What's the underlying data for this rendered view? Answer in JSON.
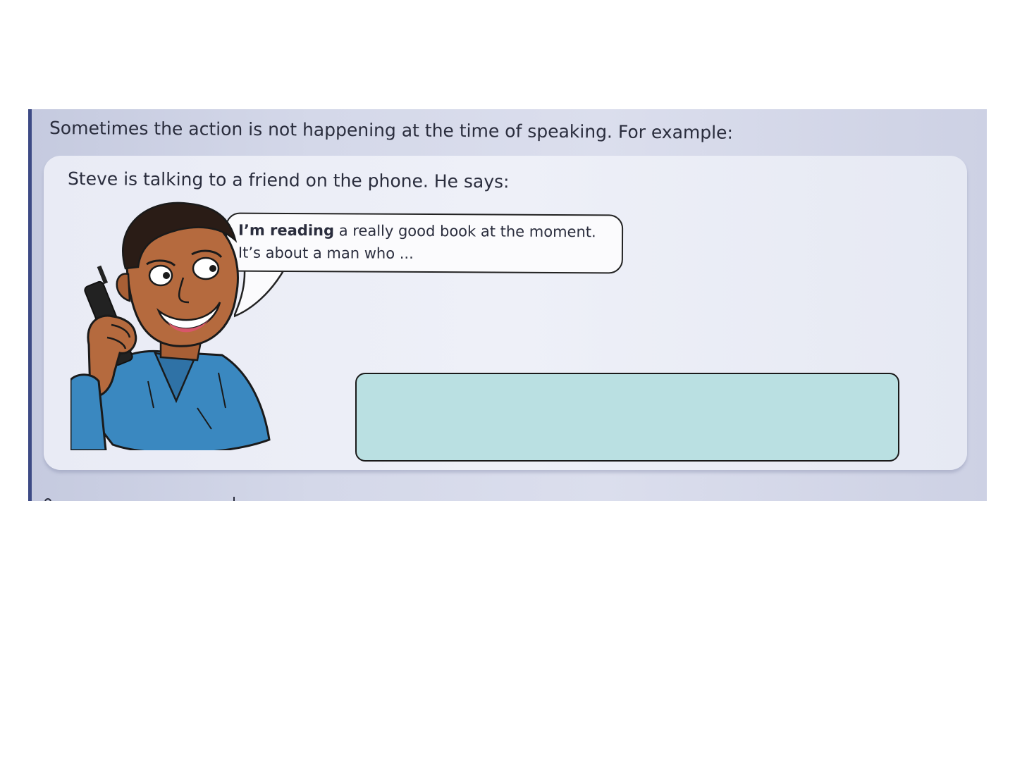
{
  "intro_sentence": "Sometimes the action is not happening at the time of speaking.  For example:",
  "example": {
    "context": "Steve is talking to a friend on the phone.  He says:",
    "speech_bold": "I’m reading",
    "speech_rest": " a really good book at the moment.",
    "speech_line2": "It’s about a man who ..."
  },
  "answer_box": {
    "text": "",
    "fill_color": "#bae0e2"
  },
  "illustration": {
    "icon": "man-on-phone-icon",
    "shirt_color": "#3a88c0",
    "skin_color": "#b56a3e"
  }
}
